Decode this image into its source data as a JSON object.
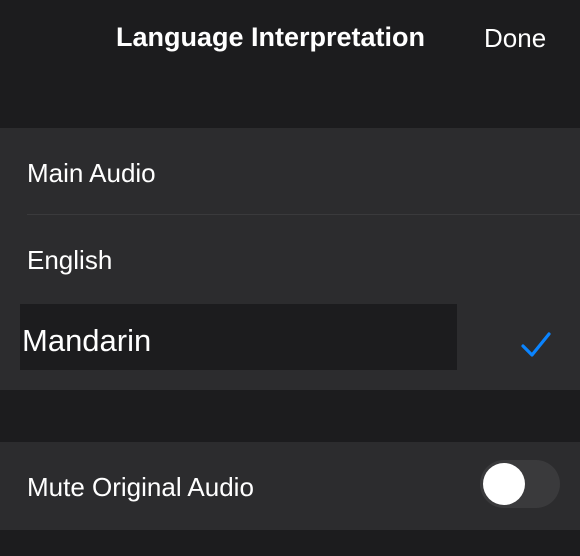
{
  "header": {
    "title": "Language Interpretation",
    "done_label": "Done"
  },
  "languages": {
    "items": [
      {
        "label": "Main Audio",
        "selected": false
      },
      {
        "label": "English",
        "selected": false
      },
      {
        "label": "Mandarin",
        "selected": true
      }
    ],
    "check_icon": "checkmark-icon",
    "check_color": "#0a84ff"
  },
  "options": {
    "mute_label": "Mute Original Audio",
    "mute_enabled": false
  },
  "colors": {
    "background": "#1c1c1e",
    "group_background": "#2c2c2e",
    "separator": "#3a3a3c",
    "accent": "#0a84ff"
  }
}
